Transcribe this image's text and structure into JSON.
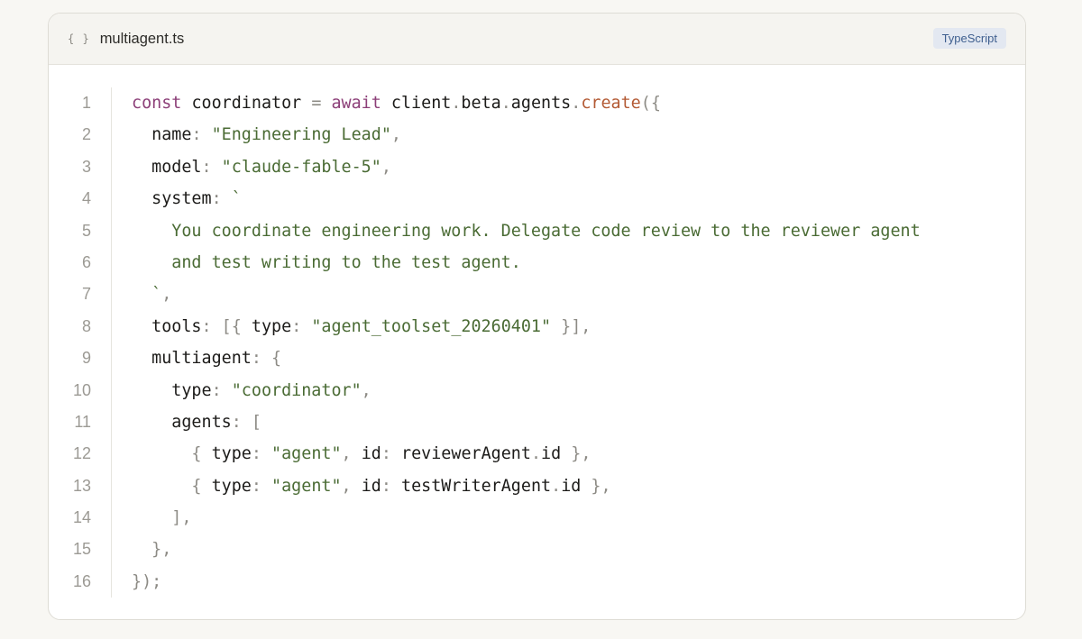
{
  "file": {
    "icon": "braces-icon",
    "icon_text": "{ }",
    "name": "multiagent.ts",
    "language": "TypeScript"
  },
  "code": {
    "lines": [
      [
        [
          "kw",
          "const"
        ],
        [
          "id",
          " coordinator "
        ],
        [
          "punc",
          "="
        ],
        [
          "kw",
          " await "
        ],
        [
          "id",
          "client"
        ],
        [
          "punc",
          "."
        ],
        [
          "id",
          "beta"
        ],
        [
          "punc",
          "."
        ],
        [
          "id",
          "agents"
        ],
        [
          "punc",
          "."
        ],
        [
          "fn",
          "create"
        ],
        [
          "punc",
          "({"
        ]
      ],
      [
        [
          "id",
          "  name"
        ],
        [
          "punc",
          ": "
        ],
        [
          "str",
          "\"Engineering Lead\""
        ],
        [
          "punc",
          ","
        ]
      ],
      [
        [
          "id",
          "  model"
        ],
        [
          "punc",
          ": "
        ],
        [
          "str",
          "\"claude-fable-5\""
        ],
        [
          "punc",
          ","
        ]
      ],
      [
        [
          "id",
          "  system"
        ],
        [
          "punc",
          ": "
        ],
        [
          "str",
          "`"
        ]
      ],
      [
        [
          "str",
          "    You coordinate engineering work. Delegate code review to the reviewer agent"
        ]
      ],
      [
        [
          "str",
          "    and test writing to the test agent."
        ]
      ],
      [
        [
          "str",
          "  `"
        ],
        [
          "punc",
          ","
        ]
      ],
      [
        [
          "id",
          "  tools"
        ],
        [
          "punc",
          ": [{ "
        ],
        [
          "id",
          "type"
        ],
        [
          "punc",
          ": "
        ],
        [
          "str",
          "\"agent_toolset_20260401\""
        ],
        [
          "punc",
          " }],"
        ]
      ],
      [
        [
          "id",
          "  multiagent"
        ],
        [
          "punc",
          ": {"
        ]
      ],
      [
        [
          "id",
          "    type"
        ],
        [
          "punc",
          ": "
        ],
        [
          "str",
          "\"coordinator\""
        ],
        [
          "punc",
          ","
        ]
      ],
      [
        [
          "id",
          "    agents"
        ],
        [
          "punc",
          ": ["
        ]
      ],
      [
        [
          "punc",
          "      { "
        ],
        [
          "id",
          "type"
        ],
        [
          "punc",
          ": "
        ],
        [
          "str",
          "\"agent\""
        ],
        [
          "punc",
          ", "
        ],
        [
          "id",
          "id"
        ],
        [
          "punc",
          ": "
        ],
        [
          "id",
          "reviewerAgent"
        ],
        [
          "punc",
          "."
        ],
        [
          "id",
          "id"
        ],
        [
          "punc",
          " },"
        ]
      ],
      [
        [
          "punc",
          "      { "
        ],
        [
          "id",
          "type"
        ],
        [
          "punc",
          ": "
        ],
        [
          "str",
          "\"agent\""
        ],
        [
          "punc",
          ", "
        ],
        [
          "id",
          "id"
        ],
        [
          "punc",
          ": "
        ],
        [
          "id",
          "testWriterAgent"
        ],
        [
          "punc",
          "."
        ],
        [
          "id",
          "id"
        ],
        [
          "punc",
          " },"
        ]
      ],
      [
        [
          "punc",
          "    ],"
        ]
      ],
      [
        [
          "punc",
          "  },"
        ]
      ],
      [
        [
          "punc",
          "});"
        ]
      ]
    ],
    "line_numbers": [
      "1",
      "2",
      "3",
      "4",
      "5",
      "6",
      "7",
      "8",
      "9",
      "10",
      "11",
      "12",
      "13",
      "14",
      "15",
      "16"
    ]
  }
}
